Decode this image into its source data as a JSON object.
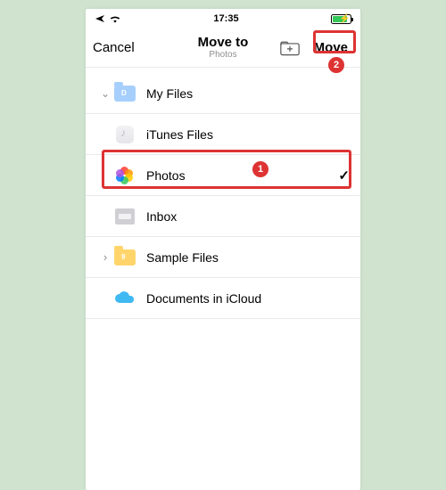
{
  "statusbar": {
    "time": "17:35"
  },
  "nav": {
    "cancel": "Cancel",
    "title": "Move to",
    "subtitle": "Photos",
    "move": "Move"
  },
  "rows": {
    "myfiles": "My Files",
    "itunes": "iTunes Files",
    "photos": "Photos",
    "inbox": "Inbox",
    "sample": "Sample Files",
    "icloud": "Documents in iCloud"
  },
  "annotations": {
    "badge1": "1",
    "badge2": "2"
  }
}
